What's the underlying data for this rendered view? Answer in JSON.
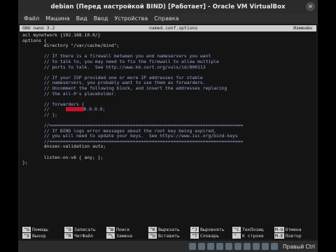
{
  "window": {
    "title": "debian (Перед настройкой BIND) [Работает] - Oracle VM VirtualBox",
    "close_icon": "close-icon"
  },
  "menu": {
    "items": [
      "Файл",
      "Машина",
      "Вид",
      "Ввод",
      "Устройства",
      "Справка"
    ]
  },
  "nano": {
    "version": "GNU nano 3.2",
    "filename": "named.conf.options",
    "modified": "Изменён",
    "lines": [
      {
        "t": "acl mynetwork {192.168.10.0/}",
        "c": "code"
      },
      {
        "t": "options {",
        "c": "code"
      },
      {
        "t": "        directory \"/var/cache/bind\";",
        "c": "code"
      },
      {
        "t": "",
        "c": "code"
      },
      {
        "t": "        // If there is a firewall between you and nameservers you want",
        "c": "comment"
      },
      {
        "t": "        // to talk to, you may need to fix the firewall to allow multiple",
        "c": "comment"
      },
      {
        "t": "        // ports to talk.  See http://www.kb.cert.org/vuls/id/800113",
        "c": "comment"
      },
      {
        "t": "",
        "c": "code"
      },
      {
        "t": "        // If your ISP provided one or more IP addresses for stable",
        "c": "comment"
      },
      {
        "t": "        // nameservers, you probably want to use them as forwarders.",
        "c": "comment"
      },
      {
        "t": "        // Uncomment the following block, and insert the addresses replacing",
        "c": "comment"
      },
      {
        "t": "        // the all-0's placeholder.",
        "c": "comment"
      },
      {
        "t": "",
        "c": "code"
      },
      {
        "t": "        // forwarders {",
        "c": "comment"
      },
      {
        "t": "        //      0.0.0.0;",
        "c": "comment",
        "redacted": true
      },
      {
        "t": "        // };",
        "c": "comment"
      },
      {
        "t": "",
        "c": "code"
      },
      {
        "t": "        //========================================================================",
        "c": "comment"
      },
      {
        "t": "        // If BIND logs error messages about the root key being expired,",
        "c": "comment"
      },
      {
        "t": "        // you will need to update your keys.  See https://www.isc.org/bind-keys",
        "c": "comment"
      },
      {
        "t": "        //========================================================================",
        "c": "comment"
      },
      {
        "t": "        dnssec-validation auto;",
        "c": "code"
      },
      {
        "t": "",
        "c": "code"
      },
      {
        "t": "        listen-on-v6 { any; };",
        "c": "code"
      },
      {
        "t": "};",
        "c": "code"
      }
    ],
    "shortcuts": [
      {
        "key": "^G",
        "label": "Помощь"
      },
      {
        "key": "^X",
        "label": "Выход"
      },
      {
        "key": "^O",
        "label": "Записать"
      },
      {
        "key": "^R",
        "label": "ЧитФайл"
      },
      {
        "key": "^W",
        "label": "Поиск"
      },
      {
        "key": "^\\",
        "label": "Замена"
      },
      {
        "key": "^K",
        "label": "Вырезать"
      },
      {
        "key": "^U",
        "label": "Вставить"
      },
      {
        "key": "^J",
        "label": "Выровнять"
      },
      {
        "key": "^T",
        "label": "Словарь"
      },
      {
        "key": "^C",
        "label": "ТекПозиц"
      },
      {
        "key": "^_",
        "label": "К строке"
      },
      {
        "key": "M-U",
        "label": "Отмена"
      },
      {
        "key": "M-E",
        "label": "Повтор"
      }
    ]
  },
  "statusbar": {
    "host_key": "Правый Ctrl",
    "icons": [
      "hdd-icon",
      "optical-icon",
      "usb-icon",
      "network-icon",
      "shared-folder-icon",
      "display-icon",
      "recording-icon",
      "cpu-icon",
      "mouse-icon",
      "keyboard-icon"
    ]
  }
}
